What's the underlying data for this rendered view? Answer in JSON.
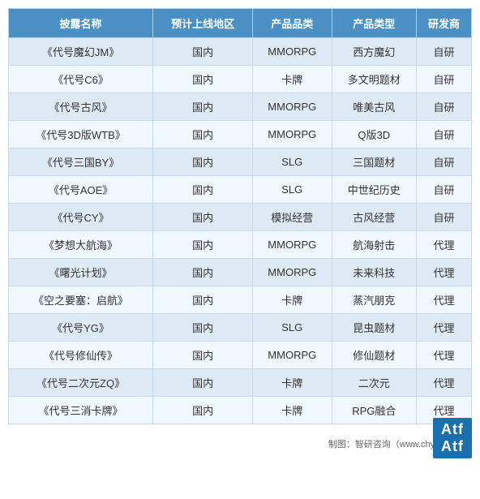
{
  "table": {
    "headers": [
      "披露名称",
      "预计上线地区",
      "产品品类",
      "产品类型",
      "研发商"
    ],
    "rows": [
      [
        "《代号魔幻JM》",
        "国内",
        "MMORPG",
        "西方魔幻",
        "自研"
      ],
      [
        "《代号C6》",
        "国内",
        "卡牌",
        "多文明题材",
        "自研"
      ],
      [
        "《代号古风》",
        "国内",
        "MMORPG",
        "唯美古风",
        "自研"
      ],
      [
        "《代号3D版WTB》",
        "国内",
        "MMORPG",
        "Q版3D",
        "自研"
      ],
      [
        "《代号三国BY》",
        "国内",
        "SLG",
        "三国题材",
        "自研"
      ],
      [
        "《代号AOE》",
        "国内",
        "SLG",
        "中世纪历史",
        "自研"
      ],
      [
        "《代号CY》",
        "国内",
        "模拟经营",
        "古风经营",
        "自研"
      ],
      [
        "《梦想大航海》",
        "国内",
        "MMORPG",
        "航海射击",
        "代理"
      ],
      [
        "《曙光计划》",
        "国内",
        "MMORPG",
        "未来科技",
        "代理"
      ],
      [
        "《空之要塞：启航》",
        "国内",
        "卡牌",
        "蒸汽朋克",
        "代理"
      ],
      [
        "《代号YG》",
        "国内",
        "SLG",
        "昆虫题材",
        "代理"
      ],
      [
        "《代号修仙传》",
        "国内",
        "MMORPG",
        "修仙题材",
        "代理"
      ],
      [
        "《代号二次元ZQ》",
        "国内",
        "卡牌",
        "二次元",
        "代理"
      ],
      [
        "《代号三消卡牌》",
        "国内",
        "卡牌",
        "RPG融合",
        "代理"
      ]
    ]
  },
  "footer": {
    "text": "制图：智研咨询（www.chyxx.com）"
  },
  "logo": {
    "line1": "Atf",
    "line2": "Atf"
  }
}
